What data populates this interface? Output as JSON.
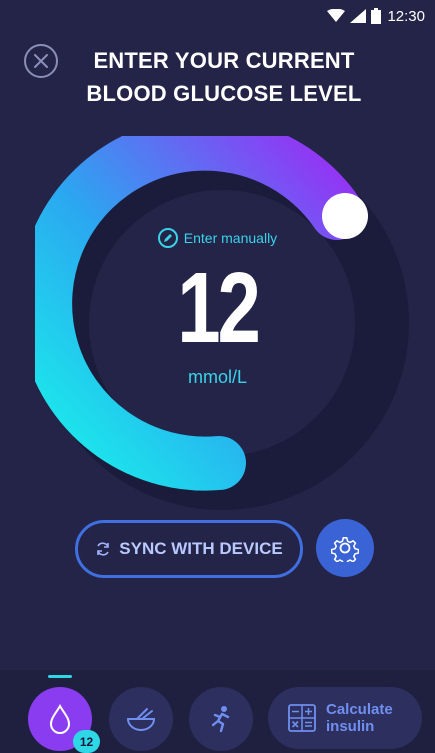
{
  "status_bar": {
    "time": "12:30",
    "icons": [
      "wifi-icon",
      "signal-icon",
      "battery-icon"
    ]
  },
  "header": {
    "title_line1": "ENTER YOUR CURRENT",
    "title_line2": "BLOOD GLUCOSE LEVEL",
    "close_icon": "close-icon"
  },
  "dial": {
    "manual_label": "Enter manually",
    "manual_icon": "edit-icon",
    "value": "12",
    "unit": "mmol/L",
    "gradient_start": "#19f2ea",
    "gradient_end": "#9b2cf5",
    "track_color": "#1b1c3b",
    "knob_color": "#ffffff"
  },
  "actions": {
    "sync_label": "SYNC WITH DEVICE",
    "sync_icon": "sync-icon",
    "settings_icon": "gear-icon"
  },
  "bottom_nav": {
    "items": [
      {
        "name": "glucose",
        "icon": "drop-icon",
        "active": true,
        "badge": "12"
      },
      {
        "name": "food",
        "icon": "bowl-icon",
        "active": false
      },
      {
        "name": "activity",
        "icon": "runner-icon",
        "active": false
      }
    ],
    "calculate_line1": "Calculate",
    "calculate_line2": "insulin",
    "calculate_icon": "calculator-icon"
  },
  "colors": {
    "background": "#232447",
    "accent_cyan": "#2ed7e6",
    "accent_blue": "#3a64d6",
    "accent_purple": "#8a3df0"
  }
}
